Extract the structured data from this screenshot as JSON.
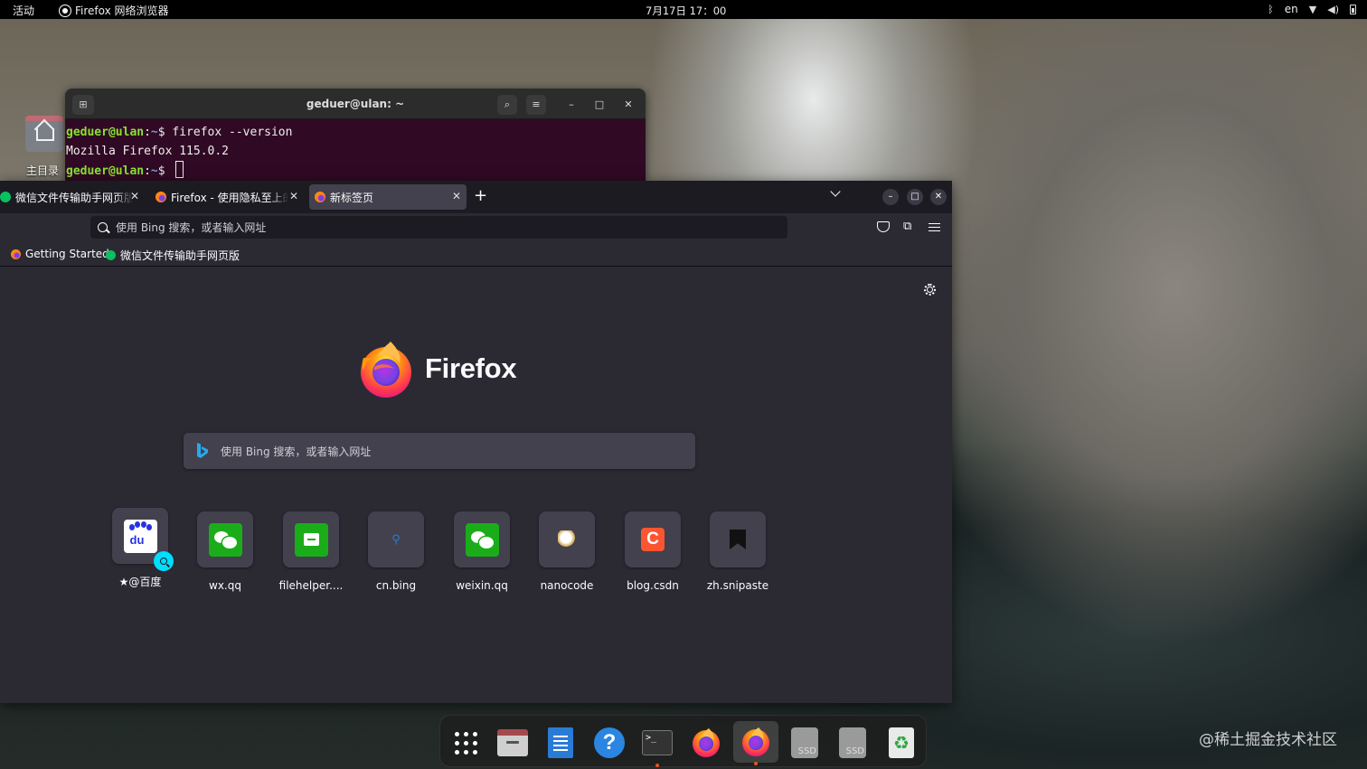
{
  "topbar": {
    "activities": "活动",
    "app_name": "Firefox 网络浏览器",
    "clock": "7月17日  17：00",
    "language": "en"
  },
  "desktop": {
    "home_label": "主目录"
  },
  "terminal": {
    "title": "geduer@ulan: ~",
    "lines": [
      {
        "user": "geduer@ulan",
        "path": "~",
        "prompt": "$ ",
        "command": "firefox --version"
      },
      {
        "output": "Mozilla Firefox 115.0.2"
      },
      {
        "user": "geduer@ulan",
        "path": "~",
        "prompt": "$ ",
        "command": ""
      }
    ]
  },
  "firefox": {
    "tabs": [
      {
        "label": "微信文件传输助手网页版",
        "icon": "wechat-favicon",
        "active": false
      },
      {
        "label": "Firefox - 使用隐私至上的浏览器",
        "icon": "firefox-favicon",
        "active": false
      },
      {
        "label": "新标签页",
        "icon": "firefox-favicon",
        "active": true
      }
    ],
    "urlbar_placeholder": "使用 Bing 搜索，或者输入网址",
    "bookmarks": [
      {
        "label": "Getting Started",
        "icon": "firefox-favicon"
      },
      {
        "label": "微信文件传输助手网页版",
        "icon": "wechat-favicon"
      }
    ],
    "wordmark": "Firefox",
    "search_placeholder": "使用 Bing 搜索，或者输入网址",
    "shortcuts": [
      {
        "label": "@百度",
        "prefix": "★",
        "icon": "baidu-icon",
        "pinned_search": true
      },
      {
        "label": "wx.qq",
        "icon": "wechat-icon"
      },
      {
        "label": "filehelper....",
        "icon": "filehelper-icon"
      },
      {
        "label": "cn.bing",
        "icon": "bing-search-icon"
      },
      {
        "label": "weixin.qq",
        "icon": "wechat-icon"
      },
      {
        "label": "nanocode",
        "icon": "nanocode-icon"
      },
      {
        "label": "blog.csdn",
        "icon": "csdn-icon"
      },
      {
        "label": "zh.snipaste",
        "icon": "snipaste-icon"
      }
    ]
  },
  "dock": {
    "items": [
      "app-grid-icon",
      "files-icon",
      "writer-icon",
      "help-icon",
      "terminal-icon",
      "firefox-icon",
      "firefox-icon",
      "ssd-icon",
      "ssd-icon",
      "trash-icon"
    ],
    "ssd_label": "SSD",
    "terminal_glyph": ">_"
  },
  "watermark": "@稀土掘金技术社区",
  "colors": {
    "terminal_bg": "#300a24",
    "firefox_bg": "#2b2a33",
    "accent": "#00ddff",
    "prompt_user": "#8ae234",
    "prompt_path": "#729fcf"
  }
}
